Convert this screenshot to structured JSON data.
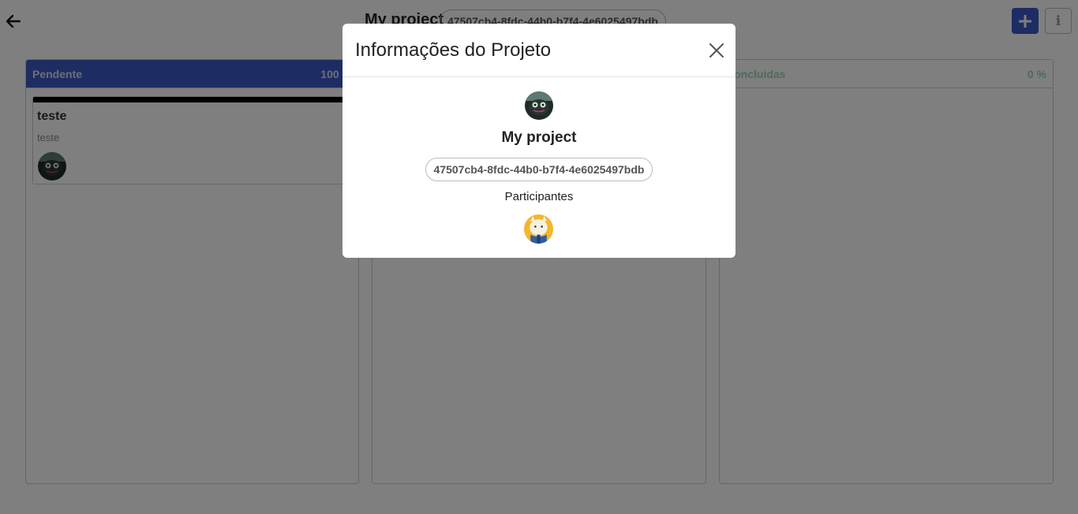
{
  "header": {
    "project_name": "My project",
    "project_id": "47507cb4-8fdc-44b0-b7f4-4e6025497bdb",
    "back_icon": "arrow-left-icon",
    "add_icon": "plus-icon",
    "info_icon": "info-icon",
    "accent_color": "#3b5bc8"
  },
  "columns": [
    {
      "title": "Pendente",
      "percent": "100 %",
      "color": "#3b5bc8",
      "cards": [
        {
          "title": "teste",
          "description": "teste",
          "close_glyph": "×",
          "bar_color": "#000000"
        }
      ]
    },
    {
      "title": "",
      "percent": "",
      "cards": []
    },
    {
      "title": "Concluidas",
      "percent": "0 %",
      "color": "#9bd6b2",
      "cards": []
    }
  ],
  "modal": {
    "title": "Informações do Projeto",
    "close_icon": "close-icon",
    "project_name": "My project",
    "project_id": "47507cb4-8fdc-44b0-b7f4-4e6025497bdb",
    "participants_label": "Participantes"
  }
}
